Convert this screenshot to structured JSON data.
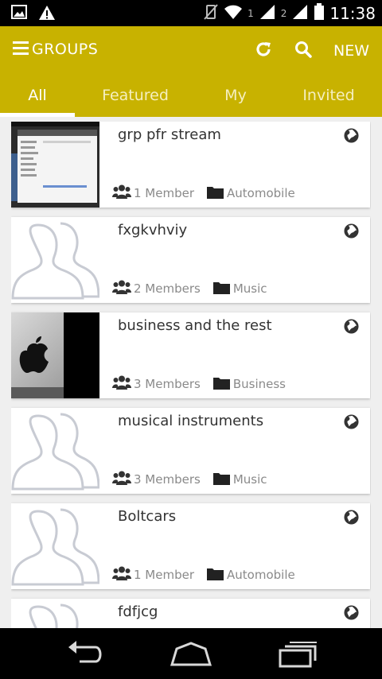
{
  "status_bar": {
    "sim1_label": "1",
    "sim2_label": "2",
    "time": "11:38"
  },
  "app_bar": {
    "title": "GROUPS",
    "new_label": "NEW",
    "accent_color": "#c8b200"
  },
  "tabs": [
    {
      "label": "All",
      "active": true
    },
    {
      "label": "Featured",
      "active": false
    },
    {
      "label": "My",
      "active": false
    },
    {
      "label": "Invited",
      "active": false
    }
  ],
  "groups": [
    {
      "name": "grp pfr stream",
      "members": "1 Member",
      "category": "Automobile",
      "thumbnail": "screenshot"
    },
    {
      "name": "fxgkvhviy",
      "members": "2 Members",
      "category": "Music",
      "thumbnail": "placeholder"
    },
    {
      "name": "business and the rest",
      "members": "3 Members",
      "category": "Business",
      "thumbnail": "apple-photo"
    },
    {
      "name": "musical instruments",
      "members": "3 Members",
      "category": "Music",
      "thumbnail": "placeholder"
    },
    {
      "name": "Boltcars",
      "members": "1 Member",
      "category": "Automobile",
      "thumbnail": "placeholder"
    },
    {
      "name": "fdfjcg",
      "members": "",
      "category": "",
      "thumbnail": "placeholder"
    }
  ]
}
